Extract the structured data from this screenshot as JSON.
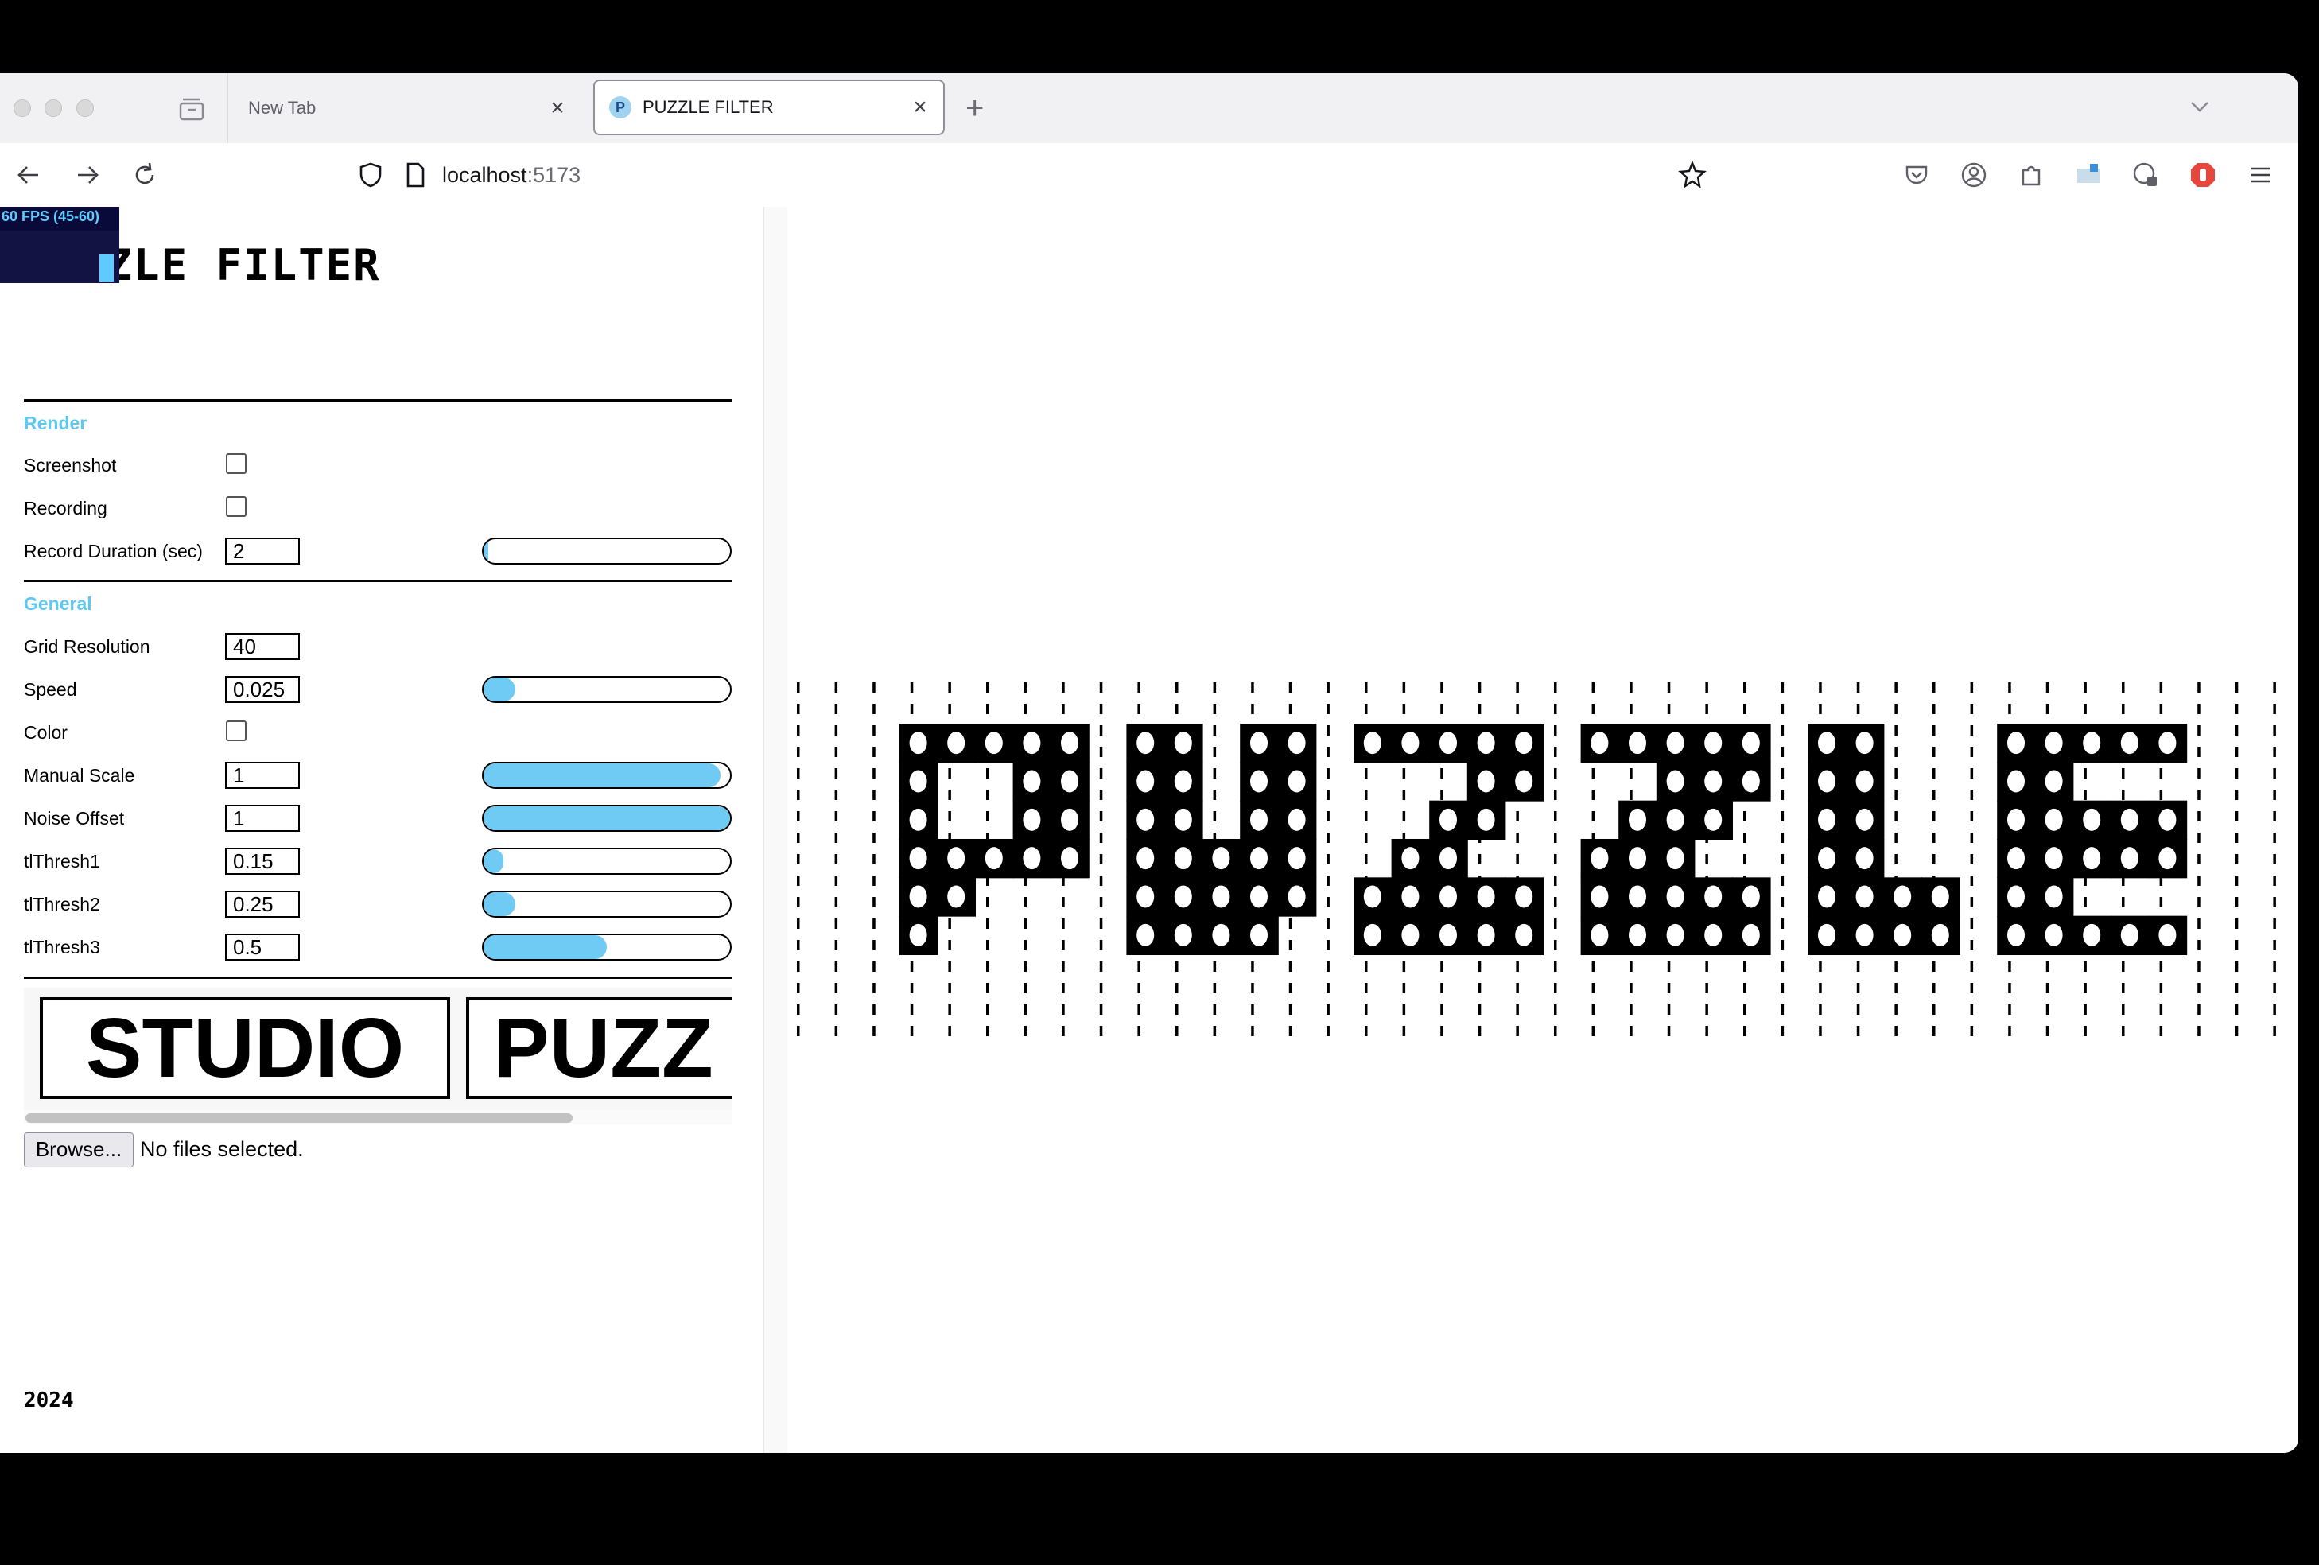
{
  "browser": {
    "tabs": [
      {
        "title": "New Tab",
        "active": false
      },
      {
        "title": "PUZZLE FILTER",
        "active": true,
        "favicon_letter": "P"
      }
    ],
    "url_host": "localhost",
    "url_port": ":5173"
  },
  "panel": {
    "fps": "60 FPS (45-60)",
    "title": "PUZZLE FILTER",
    "sections": {
      "render": "Render",
      "general": "General"
    },
    "render": {
      "screenshot_label": "Screenshot",
      "screenshot_checked": false,
      "recording_label": "Recording",
      "recording_checked": false,
      "duration_label": "Record Duration (sec)",
      "duration_value": "2",
      "duration_progress": 0
    },
    "general": {
      "grid_label": "Grid Resolution",
      "grid_value": "40",
      "speed_label": "Speed",
      "speed_value": "0.025",
      "speed_slider": 0.13,
      "color_label": "Color",
      "color_checked": false,
      "scale_label": "Manual Scale",
      "scale_value": "1",
      "scale_slider": 0.96,
      "noise_label": "Noise Offset",
      "noise_value": "1",
      "noise_slider": 1.0,
      "t1_label": "tlThresh1",
      "t1_value": "0.15",
      "t1_slider": 0.08,
      "t2_label": "tlThresh2",
      "t2_value": "0.25",
      "t2_slider": 0.13,
      "t3_label": "tlThresh3",
      "t3_value": "0.5",
      "t3_slider": 0.5
    },
    "image_strip": [
      "STUDIO",
      "PUZZ"
    ],
    "browse_label": "Browse...",
    "file_status": "No files selected.",
    "year": "2024"
  },
  "colors": {
    "accent": "#6fcbf3",
    "section": "#5ec8f0"
  }
}
